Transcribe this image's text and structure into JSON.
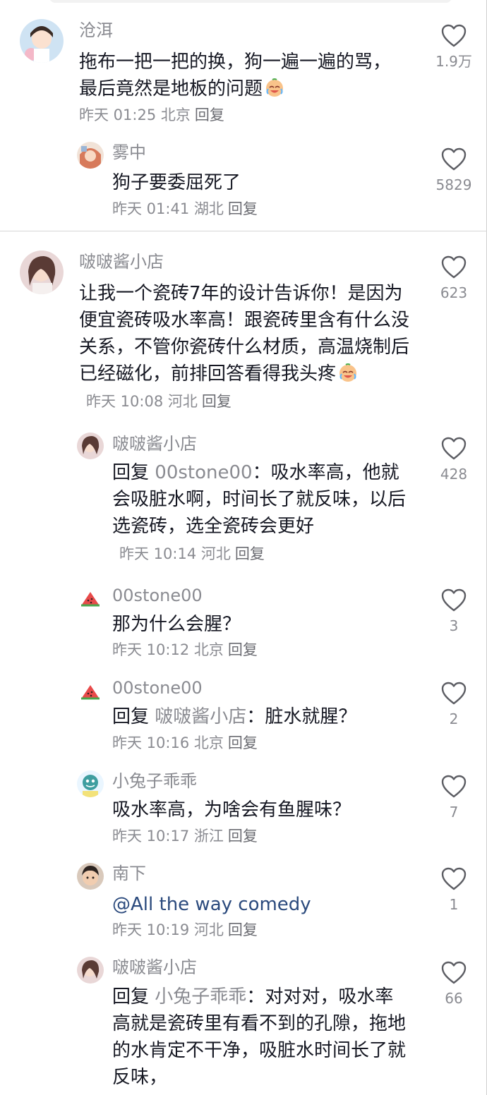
{
  "comments": [
    {
      "user": "沧洱",
      "text": "拖布一把一把的换，狗一遍一遍的骂，最后竟然是地板的问题",
      "time": "昨天 01:25",
      "location": "北京",
      "reply_label": "回复",
      "likes": "1.9万",
      "replies": [
        {
          "user": "雾中",
          "text": "狗子要委屈死了",
          "time": "昨天 01:41",
          "location": "湖北",
          "reply_label": "回复",
          "likes": "5829"
        }
      ]
    },
    {
      "user": "啵啵酱小店",
      "text": "让我一个瓷砖7年的设计告诉你！是因为便宜瓷砖吸水率高！跟瓷砖里含有什么没关系，不管你瓷砖什么材质，高温烧制后已经磁化，前排回答看得我头疼",
      "time": "昨天 10:08",
      "location": "河北",
      "reply_label": "回复",
      "likes": "623",
      "replies": [
        {
          "user": "啵啵酱小店",
          "prefix": "回复",
          "reply_to": "00stone00",
          "sep": "：",
          "text": "吸水率高，他就会吸脏水啊，时间长了就反味，以后选瓷砖，选全瓷砖会更好",
          "time": "昨天 10:14",
          "location": "河北",
          "reply_label": "回复",
          "likes": "428"
        },
        {
          "user": "00stone00",
          "text": "那为什么会腥？",
          "time": "昨天 10:12",
          "location": "北京",
          "reply_label": "回复",
          "likes": "3"
        },
        {
          "user": "00stone00",
          "prefix": "回复",
          "reply_to": "啵啵酱小店",
          "sep": "：",
          "text": "脏水就腥？",
          "time": "昨天 10:16",
          "location": "北京",
          "reply_label": "回复",
          "likes": "2"
        },
        {
          "user": "小兔子乖乖",
          "text": "吸水率高，为啥会有鱼腥味？",
          "time": "昨天 10:17",
          "location": "浙江",
          "reply_label": "回复",
          "likes": "7"
        },
        {
          "user": "南下",
          "mention": "@All the way comedy",
          "time": "昨天 10:19",
          "location": "河北",
          "reply_label": "回复",
          "likes": "1"
        },
        {
          "user": "啵啵酱小店",
          "prefix": "回复",
          "reply_to": "小兔子乖乖",
          "sep": "：",
          "text": "对对对，吸水率高就是瓷砖里有看不到的孔隙，拖地的水肯定不干净，吸脏水时间长了就反味，",
          "likes": "66"
        }
      ]
    }
  ],
  "icons": {
    "like": "heart-outline-icon",
    "emoji": "crying-laughing-emoji-icon",
    "watermelon": "watermelon-icon"
  },
  "colors": {
    "text": "#161823",
    "muted": "#8a8b91",
    "mention": "#2b4a7d",
    "divider": "#d6d6d6"
  }
}
